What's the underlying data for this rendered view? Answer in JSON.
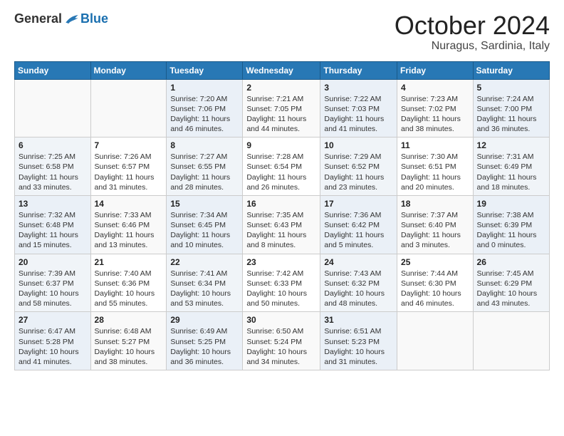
{
  "header": {
    "logo_general": "General",
    "logo_blue": "Blue",
    "month": "October 2024",
    "location": "Nuragus, Sardinia, Italy"
  },
  "days_of_week": [
    "Sunday",
    "Monday",
    "Tuesday",
    "Wednesday",
    "Thursday",
    "Friday",
    "Saturday"
  ],
  "weeks": [
    [
      {
        "day": "",
        "sunrise": "",
        "sunset": "",
        "daylight": ""
      },
      {
        "day": "",
        "sunrise": "",
        "sunset": "",
        "daylight": ""
      },
      {
        "day": "1",
        "sunrise": "Sunrise: 7:20 AM",
        "sunset": "Sunset: 7:06 PM",
        "daylight": "Daylight: 11 hours and 46 minutes."
      },
      {
        "day": "2",
        "sunrise": "Sunrise: 7:21 AM",
        "sunset": "Sunset: 7:05 PM",
        "daylight": "Daylight: 11 hours and 44 minutes."
      },
      {
        "day": "3",
        "sunrise": "Sunrise: 7:22 AM",
        "sunset": "Sunset: 7:03 PM",
        "daylight": "Daylight: 11 hours and 41 minutes."
      },
      {
        "day": "4",
        "sunrise": "Sunrise: 7:23 AM",
        "sunset": "Sunset: 7:02 PM",
        "daylight": "Daylight: 11 hours and 38 minutes."
      },
      {
        "day": "5",
        "sunrise": "Sunrise: 7:24 AM",
        "sunset": "Sunset: 7:00 PM",
        "daylight": "Daylight: 11 hours and 36 minutes."
      }
    ],
    [
      {
        "day": "6",
        "sunrise": "Sunrise: 7:25 AM",
        "sunset": "Sunset: 6:58 PM",
        "daylight": "Daylight: 11 hours and 33 minutes."
      },
      {
        "day": "7",
        "sunrise": "Sunrise: 7:26 AM",
        "sunset": "Sunset: 6:57 PM",
        "daylight": "Daylight: 11 hours and 31 minutes."
      },
      {
        "day": "8",
        "sunrise": "Sunrise: 7:27 AM",
        "sunset": "Sunset: 6:55 PM",
        "daylight": "Daylight: 11 hours and 28 minutes."
      },
      {
        "day": "9",
        "sunrise": "Sunrise: 7:28 AM",
        "sunset": "Sunset: 6:54 PM",
        "daylight": "Daylight: 11 hours and 26 minutes."
      },
      {
        "day": "10",
        "sunrise": "Sunrise: 7:29 AM",
        "sunset": "Sunset: 6:52 PM",
        "daylight": "Daylight: 11 hours and 23 minutes."
      },
      {
        "day": "11",
        "sunrise": "Sunrise: 7:30 AM",
        "sunset": "Sunset: 6:51 PM",
        "daylight": "Daylight: 11 hours and 20 minutes."
      },
      {
        "day": "12",
        "sunrise": "Sunrise: 7:31 AM",
        "sunset": "Sunset: 6:49 PM",
        "daylight": "Daylight: 11 hours and 18 minutes."
      }
    ],
    [
      {
        "day": "13",
        "sunrise": "Sunrise: 7:32 AM",
        "sunset": "Sunset: 6:48 PM",
        "daylight": "Daylight: 11 hours and 15 minutes."
      },
      {
        "day": "14",
        "sunrise": "Sunrise: 7:33 AM",
        "sunset": "Sunset: 6:46 PM",
        "daylight": "Daylight: 11 hours and 13 minutes."
      },
      {
        "day": "15",
        "sunrise": "Sunrise: 7:34 AM",
        "sunset": "Sunset: 6:45 PM",
        "daylight": "Daylight: 11 hours and 10 minutes."
      },
      {
        "day": "16",
        "sunrise": "Sunrise: 7:35 AM",
        "sunset": "Sunset: 6:43 PM",
        "daylight": "Daylight: 11 hours and 8 minutes."
      },
      {
        "day": "17",
        "sunrise": "Sunrise: 7:36 AM",
        "sunset": "Sunset: 6:42 PM",
        "daylight": "Daylight: 11 hours and 5 minutes."
      },
      {
        "day": "18",
        "sunrise": "Sunrise: 7:37 AM",
        "sunset": "Sunset: 6:40 PM",
        "daylight": "Daylight: 11 hours and 3 minutes."
      },
      {
        "day": "19",
        "sunrise": "Sunrise: 7:38 AM",
        "sunset": "Sunset: 6:39 PM",
        "daylight": "Daylight: 11 hours and 0 minutes."
      }
    ],
    [
      {
        "day": "20",
        "sunrise": "Sunrise: 7:39 AM",
        "sunset": "Sunset: 6:37 PM",
        "daylight": "Daylight: 10 hours and 58 minutes."
      },
      {
        "day": "21",
        "sunrise": "Sunrise: 7:40 AM",
        "sunset": "Sunset: 6:36 PM",
        "daylight": "Daylight: 10 hours and 55 minutes."
      },
      {
        "day": "22",
        "sunrise": "Sunrise: 7:41 AM",
        "sunset": "Sunset: 6:34 PM",
        "daylight": "Daylight: 10 hours and 53 minutes."
      },
      {
        "day": "23",
        "sunrise": "Sunrise: 7:42 AM",
        "sunset": "Sunset: 6:33 PM",
        "daylight": "Daylight: 10 hours and 50 minutes."
      },
      {
        "day": "24",
        "sunrise": "Sunrise: 7:43 AM",
        "sunset": "Sunset: 6:32 PM",
        "daylight": "Daylight: 10 hours and 48 minutes."
      },
      {
        "day": "25",
        "sunrise": "Sunrise: 7:44 AM",
        "sunset": "Sunset: 6:30 PM",
        "daylight": "Daylight: 10 hours and 46 minutes."
      },
      {
        "day": "26",
        "sunrise": "Sunrise: 7:45 AM",
        "sunset": "Sunset: 6:29 PM",
        "daylight": "Daylight: 10 hours and 43 minutes."
      }
    ],
    [
      {
        "day": "27",
        "sunrise": "Sunrise: 6:47 AM",
        "sunset": "Sunset: 5:28 PM",
        "daylight": "Daylight: 10 hours and 41 minutes."
      },
      {
        "day": "28",
        "sunrise": "Sunrise: 6:48 AM",
        "sunset": "Sunset: 5:27 PM",
        "daylight": "Daylight: 10 hours and 38 minutes."
      },
      {
        "day": "29",
        "sunrise": "Sunrise: 6:49 AM",
        "sunset": "Sunset: 5:25 PM",
        "daylight": "Daylight: 10 hours and 36 minutes."
      },
      {
        "day": "30",
        "sunrise": "Sunrise: 6:50 AM",
        "sunset": "Sunset: 5:24 PM",
        "daylight": "Daylight: 10 hours and 34 minutes."
      },
      {
        "day": "31",
        "sunrise": "Sunrise: 6:51 AM",
        "sunset": "Sunset: 5:23 PM",
        "daylight": "Daylight: 10 hours and 31 minutes."
      },
      {
        "day": "",
        "sunrise": "",
        "sunset": "",
        "daylight": ""
      },
      {
        "day": "",
        "sunrise": "",
        "sunset": "",
        "daylight": ""
      }
    ]
  ]
}
